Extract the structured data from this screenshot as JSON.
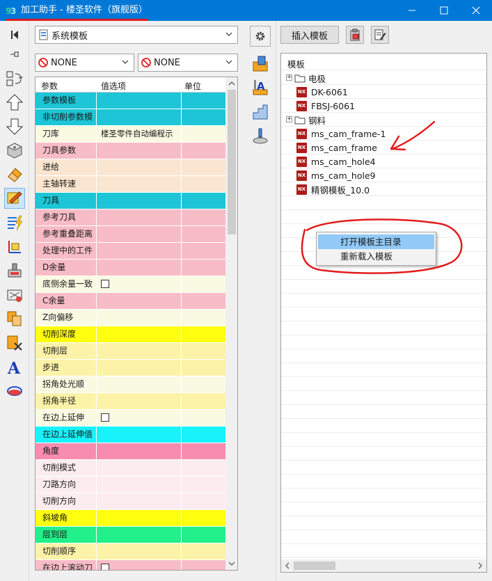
{
  "window": {
    "title": "加工助手 - 楼圣软件（旗舰版）",
    "controls": [
      "minimize",
      "maximize",
      "close"
    ]
  },
  "template_dropdown": {
    "value": "系统模板"
  },
  "none_dropdowns": [
    {
      "value": "NONE"
    },
    {
      "value": "NONE"
    }
  ],
  "grid": {
    "headers": [
      "参数",
      "值选项",
      "单位"
    ],
    "rows": [
      {
        "param": "参数模板",
        "value": "",
        "unit": "",
        "color": "#1cc6d6"
      },
      {
        "param": "非切削参数模",
        "value": "",
        "unit": "",
        "color": "#1cc6d6"
      },
      {
        "param": "刀库",
        "value": "楼圣零件自动编程示",
        "unit": "",
        "color": "#fafae3"
      },
      {
        "param": "刀具参数",
        "value": "",
        "unit": "",
        "color": "#f8bcc6"
      },
      {
        "param": "进给",
        "value": "",
        "unit": "",
        "color": "#fae6d0"
      },
      {
        "param": "主轴转速",
        "value": "",
        "unit": "",
        "color": "#fae6d0"
      },
      {
        "param": "刀具",
        "value": "",
        "unit": "",
        "color": "#1cc6d6"
      },
      {
        "param": "参考刀具",
        "value": "",
        "unit": "",
        "color": "#f8bcc6"
      },
      {
        "param": "参考重叠距离",
        "value": "",
        "unit": "",
        "color": "#f8bcc6"
      },
      {
        "param": "处理中的工件",
        "value": "",
        "unit": "",
        "color": "#f8bcc6"
      },
      {
        "param": "D余量",
        "value": "",
        "unit": "",
        "color": "#f8bcc6"
      },
      {
        "param": "底侧余量一致",
        "value": "",
        "unit": "",
        "color": "#fafae3",
        "checkbox": true
      },
      {
        "param": "C余量",
        "value": "",
        "unit": "",
        "color": "#f8bcc6"
      },
      {
        "param": "Z向偏移",
        "value": "",
        "unit": "",
        "color": "#fafae3"
      },
      {
        "param": "切削深度",
        "value": "",
        "unit": "",
        "color": "#ffff10"
      },
      {
        "param": "切削层",
        "value": "",
        "unit": "",
        "color": "#fdf3a8"
      },
      {
        "param": "步进",
        "value": "",
        "unit": "",
        "color": "#fdf3a8"
      },
      {
        "param": "拐角处光顺",
        "value": "",
        "unit": "",
        "color": "#fafae3"
      },
      {
        "param": "拐角半径",
        "value": "",
        "unit": "",
        "color": "#fdf3a8"
      },
      {
        "param": "在边上延伸",
        "value": "",
        "unit": "",
        "color": "#fafae3",
        "checkbox": true
      },
      {
        "param": "在边上延伸值",
        "value": "",
        "unit": "",
        "color": "#18f2fb"
      },
      {
        "param": "角度",
        "value": "",
        "unit": "",
        "color": "#f78cb0"
      },
      {
        "param": "切削模式",
        "value": "",
        "unit": "",
        "color": "#fcecf0"
      },
      {
        "param": "刀路方向",
        "value": "",
        "unit": "",
        "color": "#fcecf0"
      },
      {
        "param": "切削方向",
        "value": "",
        "unit": "",
        "color": "#fcecf0"
      },
      {
        "param": "斜坡角",
        "value": "",
        "unit": "",
        "color": "#ffff10"
      },
      {
        "param": "层到层",
        "value": "",
        "unit": "",
        "color": "#22f08a"
      },
      {
        "param": "切削顺序",
        "value": "",
        "unit": "",
        "color": "#fdf3a8"
      },
      {
        "param": "在边上滚动刀",
        "value": "",
        "unit": "",
        "color": "#f8bcc6",
        "checkbox": true
      }
    ]
  },
  "right_toolbar": {
    "insert_template": "插入模板"
  },
  "tree": {
    "header": "模板",
    "nodes": [
      {
        "label": "电极",
        "type": "folder",
        "expander": "+"
      },
      {
        "label": "DK-6061",
        "type": "nx"
      },
      {
        "label": "FBSJ-6061",
        "type": "nx"
      },
      {
        "label": "钢料",
        "type": "folder",
        "expander": "+"
      },
      {
        "label": "ms_cam_frame-1",
        "type": "nx"
      },
      {
        "label": "ms_cam_frame",
        "type": "nx"
      },
      {
        "label": "ms_cam_hole4",
        "type": "nx"
      },
      {
        "label": "ms_cam_hole9",
        "type": "nx"
      },
      {
        "label": "精钢模板_10.0",
        "type": "nx"
      }
    ],
    "nx_badge": "NX"
  },
  "context_menu": {
    "items": [
      "打开模板主目录",
      "重新载入模板"
    ],
    "highlighted_index": 0
  },
  "annotation_color": "#e21b1b"
}
